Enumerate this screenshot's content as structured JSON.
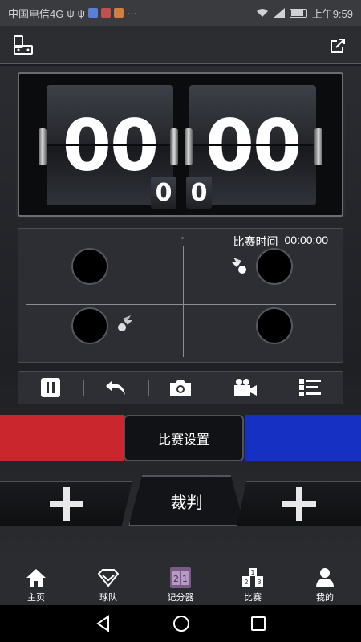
{
  "status_bar": {
    "carrier": "中国电信4G",
    "more": "···",
    "time": "上午9:59"
  },
  "scoreboard": {
    "left_score": "00",
    "right_score": "00",
    "left_small": "0",
    "right_small": "0"
  },
  "court": {
    "time_label": "比赛时间",
    "time_value": "00:00:00"
  },
  "controls": {
    "icons": [
      "pause-icon",
      "undo-icon",
      "camera-icon",
      "video-camera-icon",
      "list-icon"
    ]
  },
  "actions": {
    "settings_label": "比赛设置",
    "referee_label": "裁判"
  },
  "colors": {
    "team_left": "#c9262e",
    "team_right": "#1630c4"
  },
  "tabbar": {
    "items": [
      {
        "label": "主页",
        "icon": "home-icon"
      },
      {
        "label": "球队",
        "icon": "team-icon"
      },
      {
        "label": "记分器",
        "icon": "scoreboard-icon"
      },
      {
        "label": "比赛",
        "icon": "match-icon"
      },
      {
        "label": "我的",
        "icon": "profile-icon"
      }
    ]
  }
}
